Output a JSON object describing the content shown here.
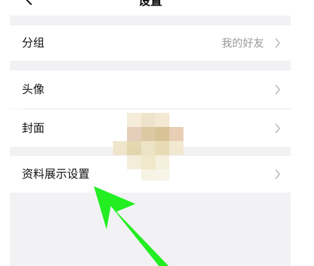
{
  "nav": {
    "title": "设置",
    "back_icon": "chevron-left-icon"
  },
  "rows": [
    {
      "label": "分组",
      "value": "我的好友",
      "icon": "chevron-right-icon"
    },
    {
      "label": "头像",
      "icon": "chevron-right-icon"
    },
    {
      "label": "封面",
      "icon": "chevron-right-icon"
    },
    {
      "label": "资料展示设置",
      "icon": "chevron-right-icon"
    }
  ],
  "colors": {
    "background": "#f2f2f5",
    "row": "#ffffff",
    "secondary_text": "#999999",
    "annotation_arrow": "#22ee22"
  }
}
